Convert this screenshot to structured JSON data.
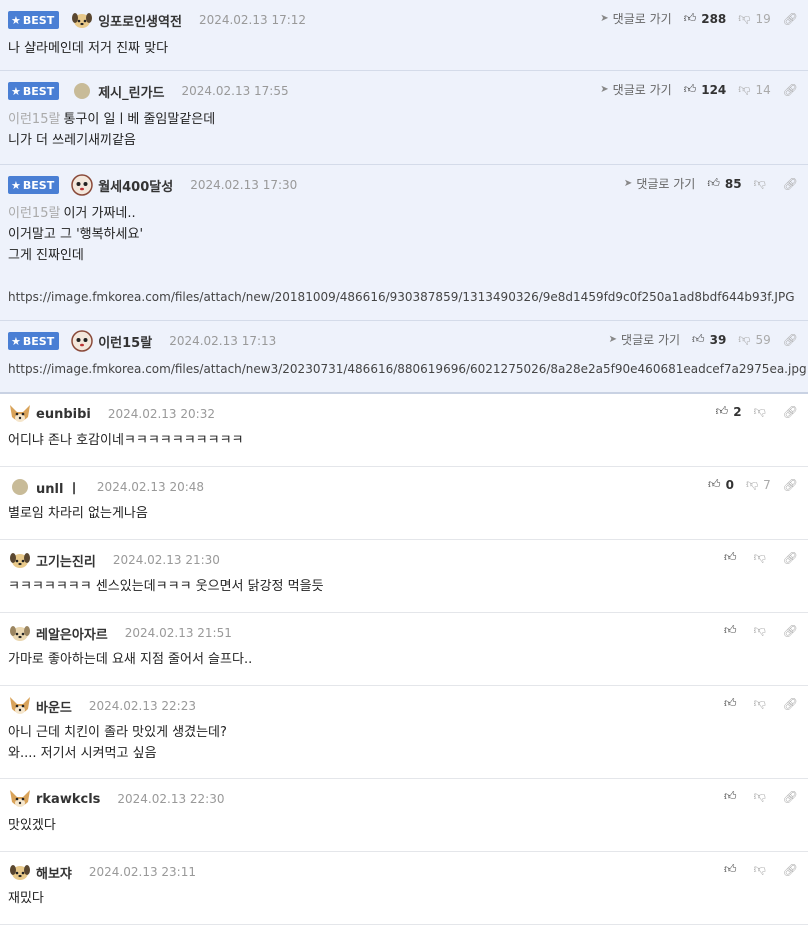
{
  "best_label": "BEST",
  "goto_label": "댓글로 가기",
  "best_comments": [
    {
      "nick": "잉포로인생역전",
      "date": "2024.02.13 17:12",
      "up": "288",
      "down": "19",
      "reply_to": "",
      "text": "나 샬라메인데 저거 진짜 맞다",
      "url": ""
    },
    {
      "nick": "제시_린가드",
      "date": "2024.02.13 17:55",
      "up": "124",
      "down": "14",
      "reply_to": "이런15랄",
      "text": "통구이 일ㅣ베 줄임말같은데\n니가 더 쓰레기새끼같음",
      "url": ""
    },
    {
      "nick": "월세400달성",
      "date": "2024.02.13 17:30",
      "up": "85",
      "down": "",
      "reply_to": "이런15랄",
      "text": "이거 가짜네..\n이거말고 그 '행복하세요'\n그게 진짜인데\n",
      "url": "https://image.fmkorea.com/files/attach/new/20181009/486616/930387859/1313490326/9e8d1459fd9c0f250a1ad8bdf644b93f.JPG"
    },
    {
      "nick": "이런15랄",
      "date": "2024.02.13 17:13",
      "up": "39",
      "down": "59",
      "reply_to": "",
      "text": "",
      "url": "https://image.fmkorea.com/files/attach/new3/20230731/486616/880619696/6021275026/8a28e2a5f90e460681eadcef7a2975ea.jpg"
    }
  ],
  "comments": [
    {
      "nick": "eunbibi",
      "date": "2024.02.13 20:32",
      "up": "2",
      "down": "",
      "text": "어디냐 존나 호감이네ㅋㅋㅋㅋㅋㅋㅋㅋㅋㅋ"
    },
    {
      "nick": "unll ㅣ",
      "date": "2024.02.13 20:48",
      "up": "0",
      "down": "7",
      "text": "별로임 차라리 없는게나음"
    },
    {
      "nick": "고기는진리",
      "date": "2024.02.13 21:30",
      "up": "",
      "down": "",
      "text": "ㅋㅋㅋㅋㅋㅋㅋ 센스있는데ㅋㅋㅋ 웃으면서 닭강정 먹을듯"
    },
    {
      "nick": "레알은아자르",
      "date": "2024.02.13 21:51",
      "up": "",
      "down": "",
      "text": "가마로 좋아하는데 요새 지점 줄어서 슬프다.."
    },
    {
      "nick": "바운드",
      "date": "2024.02.13 22:23",
      "up": "",
      "down": "",
      "text": "아니 근데 치킨이 졸라 맛있게 생겼는데?\n와.... 저기서 시켜먹고 싶음"
    },
    {
      "nick": "rkawkcls",
      "date": "2024.02.13 22:30",
      "up": "",
      "down": "",
      "text": "맛있겠다"
    },
    {
      "nick": "해보쟈",
      "date": "2024.02.13 23:11",
      "up": "",
      "down": "",
      "text": "재밌다"
    }
  ]
}
